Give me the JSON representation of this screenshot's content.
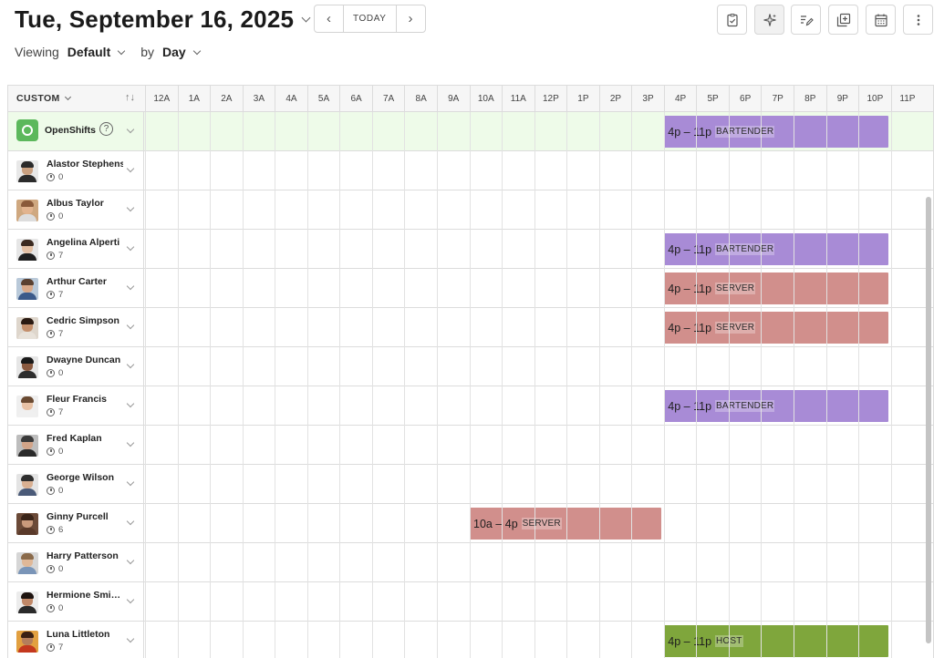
{
  "header": {
    "date": "Tue, September 16, 2025",
    "today_label": "TODAY",
    "prev_icon": "chevron-left-icon",
    "next_icon": "chevron-right-icon"
  },
  "toolbar": {
    "buttons": [
      {
        "name": "clipboard-check-icon"
      },
      {
        "name": "sparkle-icon"
      },
      {
        "name": "edit-list-icon"
      },
      {
        "name": "copy-add-icon"
      },
      {
        "name": "calendar-icon"
      },
      {
        "name": "more-vertical-icon"
      }
    ]
  },
  "viewing": {
    "label": "Viewing",
    "value": "Default",
    "by_label": "by",
    "by_value": "Day"
  },
  "grid": {
    "sort_label": "CUSTOM",
    "sort_icon": "sort-arrows-icon",
    "hours": [
      "12A",
      "1A",
      "2A",
      "3A",
      "4A",
      "5A",
      "6A",
      "7A",
      "8A",
      "9A",
      "10A",
      "11A",
      "12P",
      "1P",
      "2P",
      "3P",
      "4P",
      "5P",
      "6P",
      "7P",
      "8P",
      "9P",
      "10P",
      "11P"
    ],
    "open_shifts": {
      "label": "OpenShifts",
      "help": "?",
      "shifts": [
        {
          "start": 16,
          "end": 23,
          "time": "4p – 11p",
          "position": "BARTENDER",
          "color": "#a88bd6"
        }
      ]
    },
    "employees": [
      {
        "name": "Alastor Stephens",
        "hours": "0",
        "skin": "#c9a080",
        "hair": "#2a2a2a",
        "shirt": "#2b2b2b",
        "bg": "#e8e8e8",
        "shifts": []
      },
      {
        "name": "Albus Taylor",
        "hours": "0",
        "skin": "#e2b48f",
        "hair": "#8a5a3a",
        "shirt": "#dddddd",
        "bg": "#cfa880",
        "shifts": []
      },
      {
        "name": "Angelina Alperti",
        "hours": "7",
        "skin": "#e3c0a4",
        "hair": "#3b2a20",
        "shirt": "#1f1f1f",
        "bg": "#e6e6e6",
        "shifts": [
          {
            "start": 16,
            "end": 23,
            "time": "4p – 11p",
            "position": "BARTENDER",
            "color": "#a88bd6"
          }
        ]
      },
      {
        "name": "Arthur Carter",
        "hours": "7",
        "skin": "#d8a98a",
        "hair": "#5a4030",
        "shirt": "#3b5a8a",
        "bg": "#b9c9d9",
        "shifts": [
          {
            "start": 16,
            "end": 23,
            "time": "4p – 11p",
            "position": "SERVER",
            "color": "#d18f8c"
          }
        ]
      },
      {
        "name": "Cedric Simpson",
        "hours": "7",
        "skin": "#c48f6c",
        "hair": "#2a1a12",
        "shirt": "#e8e2da",
        "bg": "#ded6cc",
        "shifts": [
          {
            "start": 16,
            "end": 23,
            "time": "4p – 11p",
            "position": "SERVER",
            "color": "#d18f8c"
          }
        ]
      },
      {
        "name": "Dwayne Duncan",
        "hours": "0",
        "skin": "#8a5a40",
        "hair": "#1a1a1a",
        "shirt": "#2e2e2e",
        "bg": "#e6e6e6",
        "shifts": []
      },
      {
        "name": "Fleur Francis",
        "hours": "7",
        "skin": "#e8c2a6",
        "hair": "#6a4a32",
        "shirt": "#f0f0f0",
        "bg": "#efefef",
        "shifts": [
          {
            "start": 16,
            "end": 23,
            "time": "4p – 11p",
            "position": "BARTENDER",
            "color": "#a88bd6"
          }
        ]
      },
      {
        "name": "Fred Kaplan",
        "hours": "0",
        "skin": "#d2a488",
        "hair": "#3a3a3a",
        "shirt": "#2a2a2a",
        "bg": "#bdbdbd",
        "shifts": []
      },
      {
        "name": "George Wilson",
        "hours": "0",
        "skin": "#d9b092",
        "hair": "#2e2e2e",
        "shirt": "#4a5a78",
        "bg": "#e4e4e4",
        "shifts": []
      },
      {
        "name": "Ginny Purcell",
        "hours": "6",
        "skin": "#c99a7c",
        "hair": "#3a2418",
        "shirt": "#5a3a2a",
        "bg": "#6b4a38",
        "shifts": [
          {
            "start": 10,
            "end": 16,
            "time": "10a – 4p",
            "position": "SERVER",
            "color": "#d18f8c"
          }
        ]
      },
      {
        "name": "Harry Patterson",
        "hours": "0",
        "skin": "#e0b898",
        "hair": "#8a6a4a",
        "shirt": "#7a95b8",
        "bg": "#d6d6d6",
        "shifts": []
      },
      {
        "name": "Hermione Smi…",
        "hours": "0",
        "skin": "#c08868",
        "hair": "#1e1410",
        "shirt": "#2a2a2a",
        "bg": "#ececec",
        "shifts": []
      },
      {
        "name": "Luna Littleton",
        "hours": "7",
        "skin": "#b47e5c",
        "hair": "#3a2014",
        "shirt": "#c4381e",
        "bg": "#e2a040",
        "shifts": [
          {
            "start": 16,
            "end": 23,
            "time": "4p – 11p",
            "position": "HOST",
            "color": "#7fa63c"
          }
        ]
      }
    ]
  }
}
